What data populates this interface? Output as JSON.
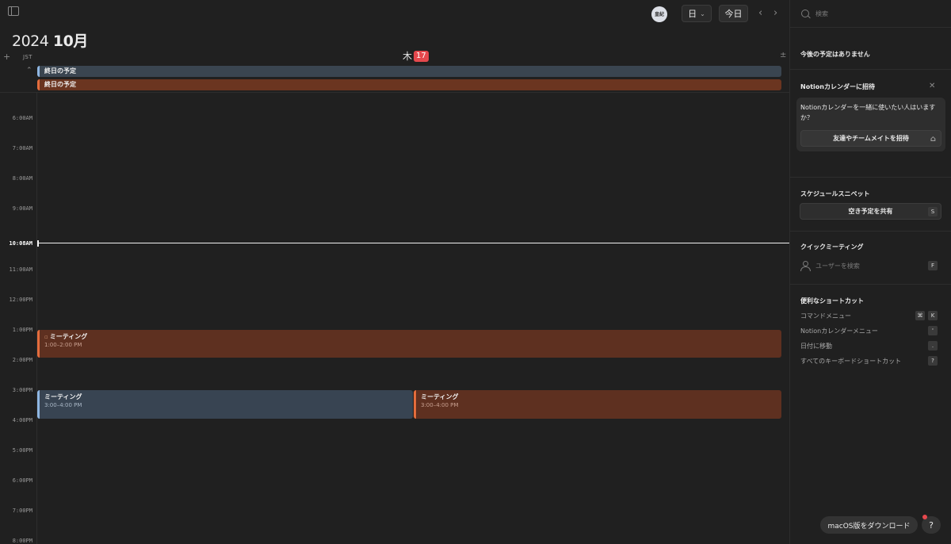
{
  "header": {
    "avatar_text": "皇紀",
    "view_label": "日",
    "today_label": "今日",
    "prev_icon": "‹",
    "next_icon": "›",
    "year": "2024",
    "month": "10月"
  },
  "calendar": {
    "timezone": "JST",
    "day_of_week": "木",
    "day_number": "17",
    "all_day_events": [
      {
        "title": "終日の予定",
        "color": "#8fb7e3"
      },
      {
        "title": "終日の予定",
        "color": "#e46c3c"
      }
    ],
    "time_labels": [
      "6:00AM",
      "7:00AM",
      "8:00AM",
      "9:00AM",
      "11:00AM",
      "12:00PM",
      "1:00PM",
      "2:00PM",
      "3:00PM",
      "4:00PM",
      "5:00PM",
      "6:00PM",
      "7:00PM",
      "8:00PM"
    ],
    "current_time": "10:08AM",
    "events": [
      {
        "title": "ミーティング",
        "time": "1:00–2:00 PM",
        "color": "#e46c3c"
      },
      {
        "title": "ミーティング",
        "time": "3:00–4:00 PM",
        "color": "#8fb7e3"
      },
      {
        "title": "ミーティング",
        "time": "3:00–4:00 PM",
        "color": "#e46c3c"
      }
    ]
  },
  "side": {
    "search_placeholder": "検索",
    "upcoming_empty": "今後の予定はありません",
    "invite": {
      "heading": "Notionカレンダーに招待",
      "prompt": "Notionカレンダーを一緒に使いたい人はいますか？",
      "button": "友達やチームメイトを招待"
    },
    "snippets": {
      "heading": "スケジュールスニペット",
      "button": "空き予定を共有",
      "key": "S"
    },
    "quick_meeting": {
      "heading": "クイックミーティング",
      "placeholder": "ユーザーを検索",
      "key": "F"
    },
    "shortcuts": {
      "heading": "便利なショートカット",
      "items": [
        {
          "label": "コマンドメニュー",
          "keys": [
            "⌘",
            "K"
          ]
        },
        {
          "label": "Notionカレンダーメニュー",
          "keys": [
            "'"
          ]
        },
        {
          "label": "日付に移動",
          "keys": [
            "."
          ]
        },
        {
          "label": "すべてのキーボードショートカット",
          "keys": [
            "?"
          ]
        }
      ]
    }
  },
  "footer": {
    "download": "macOS版をダウンロード",
    "help": "?"
  },
  "colors": {
    "accent_red": "#e5484d",
    "event_orange": "#e46c3c",
    "event_blue": "#8fb7e3"
  }
}
